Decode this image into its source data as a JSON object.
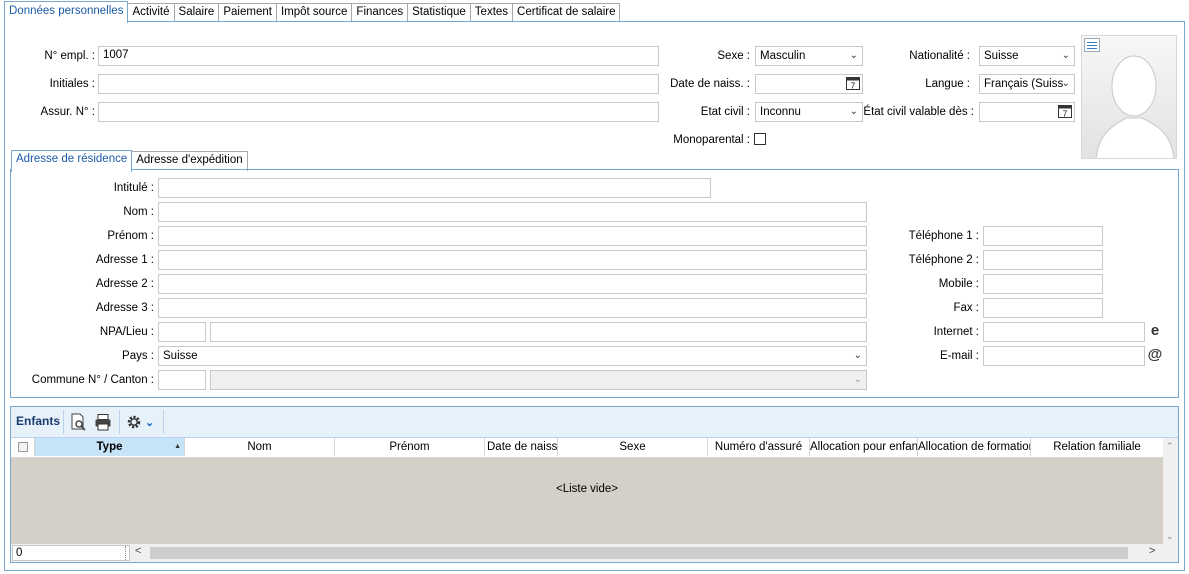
{
  "tabs": [
    "Données personnelles",
    "Activité",
    "Salaire",
    "Paiement",
    "Impôt source",
    "Finances",
    "Statistique",
    "Textes",
    "Certificat de salaire"
  ],
  "personal": {
    "emp_no_label": "N° empl. :",
    "emp_no_value": "1007",
    "initials_label": "Initiales :",
    "initials_value": "",
    "insur_label": "Assur. N° :",
    "insur_value": "",
    "sexe_label": "Sexe :",
    "sexe_value": "Masculin",
    "birth_label": "Date de naiss. :",
    "birth_value": "",
    "civil_label": "Etat civil :",
    "civil_value": "Inconnu",
    "monoparental_label": "Monoparental :",
    "nationality_label": "Nationalité :",
    "nationality_value": "Suisse",
    "language_label": "Langue :",
    "language_value": "Français (Suiss",
    "civil_valid_label": "État civil valable dès :",
    "civil_valid_value": ""
  },
  "address_tabs": [
    "Adresse de résidence",
    "Adresse d'expédition"
  ],
  "address": {
    "intitule_label": "Intitulé :",
    "nom_label": "Nom :",
    "prenom_label": "Prénom :",
    "adr1_label": "Adresse 1 :",
    "adr2_label": "Adresse 2 :",
    "adr3_label": "Adresse 3 :",
    "npa_label": "NPA/Lieu :",
    "pays_label": "Pays :",
    "pays_value": "Suisse",
    "commune_label": "Commune N° / Canton :",
    "tel1_label": "Téléphone 1 :",
    "tel2_label": "Téléphone 2 :",
    "mobile_label": "Mobile :",
    "fax_label": "Fax :",
    "internet_label": "Internet :",
    "email_label": "E-mail :"
  },
  "children": {
    "title": "Enfants",
    "columns": [
      "Type",
      "Nom",
      "Prénom",
      "Date de naissa",
      "Sexe",
      "Numéro d'assuré",
      "Allocation pour enfant",
      "Allocation de formation",
      "Relation familiale"
    ],
    "empty_text": "<Liste vide>",
    "count": "0"
  },
  "icons": {
    "calendar_day": "7"
  },
  "colors": {
    "accent": "#1a5aa6",
    "border": "#7aa7cf",
    "toolbar_bg": "#e7f1fa",
    "list_bg": "#d4d0c8"
  }
}
